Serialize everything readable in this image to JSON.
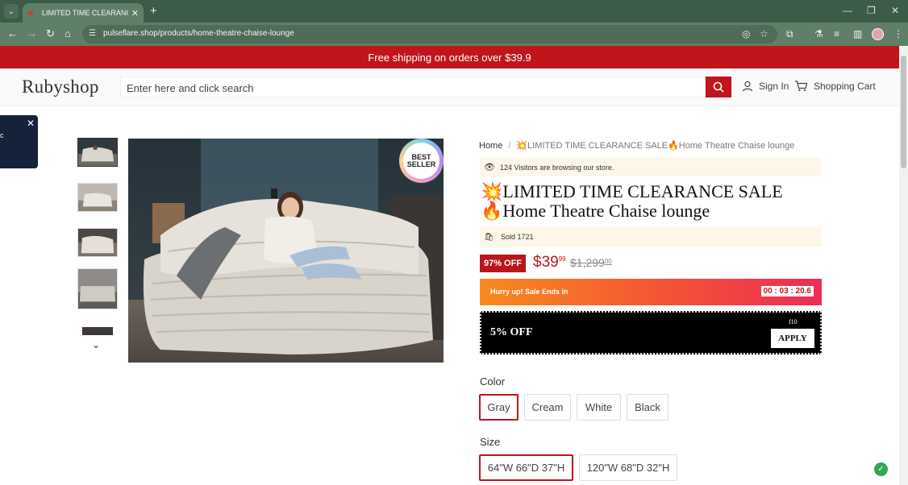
{
  "browser": {
    "tab_title": "LIMITED TIME CLEARANCE S",
    "url": "pulseflare.shop/products/home-theatre-chaise-lounge"
  },
  "announcement": "Free shipping on orders over $39.9",
  "header": {
    "logo": "Rubyshop",
    "search_placeholder": "Enter here and click search",
    "sign_in": "Sign In",
    "cart": "Shopping Cart"
  },
  "popup": {
    "text": "c"
  },
  "badge": {
    "line1": "BEST",
    "line2": "SELLER"
  },
  "breadcrumb": {
    "home": "Home",
    "separator": "/",
    "current": "💥LIMITED TIME CLEARANCE SALE🔥Home Theatre Chaise lounge"
  },
  "visitors": "124 Visitors are browsing our store.",
  "product": {
    "title_line1": "💥LIMITED TIME CLEARANCE SALE",
    "title_line2": "🔥Home Theatre Chaise lounge",
    "sold": "Sold 1721",
    "discount": "97% OFF",
    "price_main": "$39",
    "price_cents": "99",
    "old_price_main": "$1,299",
    "old_price_cents": "00"
  },
  "sale": {
    "hurry_text": "Hurry up! Sale Ends in",
    "timer": "00 : 03 : 20.6"
  },
  "coupon": {
    "label": "5% OFF",
    "code": "f10",
    "apply": "APPLY"
  },
  "color": {
    "label": "Color",
    "options": [
      "Gray",
      "Cream",
      "White",
      "Black"
    ],
    "selected": "Gray"
  },
  "size": {
    "label": "Size",
    "options": [
      "64\"W 66\"D 37\"H",
      "120\"W 68\"D 32\"H"
    ],
    "selected": "64\"W 66\"D 37\"H"
  },
  "colors": {
    "brand_red": "#c0161b",
    "chrome_green": "#5f7f69",
    "tab_strip": "#3d5c47"
  }
}
